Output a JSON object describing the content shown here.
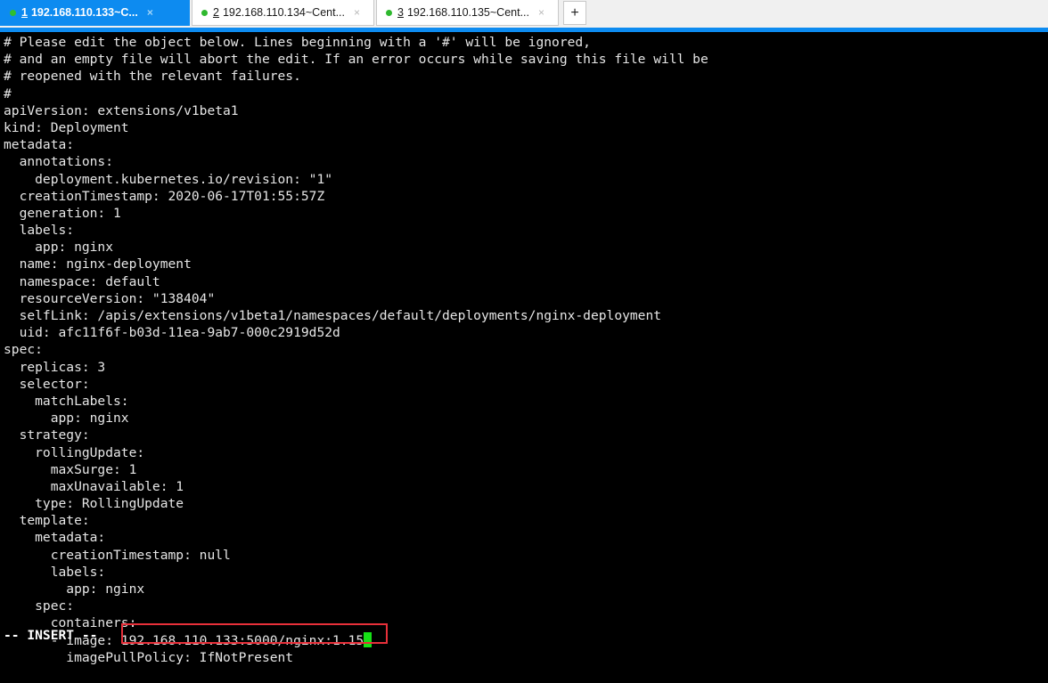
{
  "window": {
    "accent_color": "#0d8bf0",
    "tabbar_background": "#f0f0f0"
  },
  "tabs": {
    "new_tab_label": "+",
    "close_glyph": "×",
    "items": [
      {
        "number": "1",
        "title": "192.168.110.133~C...",
        "active": true,
        "status_dot": "green"
      },
      {
        "number": "2",
        "title": "192.168.110.134~Cent...",
        "active": false,
        "status_dot": "green"
      },
      {
        "number": "3",
        "title": "192.168.110.135~Cent...",
        "active": false,
        "status_dot": "green"
      }
    ]
  },
  "terminal": {
    "foreground": "#e6e6e6",
    "background": "#000000",
    "cursor_color": "#16e016",
    "status_text": "-- INSERT --",
    "lines": [
      "# Please edit the object below. Lines beginning with a '#' will be ignored,",
      "# and an empty file will abort the edit. If an error occurs while saving this file will be",
      "# reopened with the relevant failures.",
      "#",
      "apiVersion: extensions/v1beta1",
      "kind: Deployment",
      "metadata:",
      "  annotations:",
      "    deployment.kubernetes.io/revision: \"1\"",
      "  creationTimestamp: 2020-06-17T01:55:57Z",
      "  generation: 1",
      "  labels:",
      "    app: nginx",
      "  name: nginx-deployment",
      "  namespace: default",
      "  resourceVersion: \"138404\"",
      "  selfLink: /apis/extensions/v1beta1/namespaces/default/deployments/nginx-deployment",
      "  uid: afc11f6f-b03d-11ea-9ab7-000c2919d52d",
      "spec:",
      "  replicas: 3",
      "  selector:",
      "    matchLabels:",
      "      app: nginx",
      "  strategy:",
      "    rollingUpdate:",
      "      maxSurge: 1",
      "      maxUnavailable: 1",
      "    type: RollingUpdate",
      "  template:",
      "    metadata:",
      "      creationTimestamp: null",
      "      labels:",
      "        app: nginx",
      "    spec:",
      "      containers:"
    ],
    "edited_line": {
      "prefix": "      - image: ",
      "value": "192.168.110.133:5000/nginx:1.15",
      "has_cursor": true
    },
    "lines_after": [
      "        imagePullPolicy: IfNotPresent"
    ]
  },
  "annotation": {
    "color": "#e8303a",
    "target_text": "192.168.110.133:5000/nginx:1.15"
  }
}
